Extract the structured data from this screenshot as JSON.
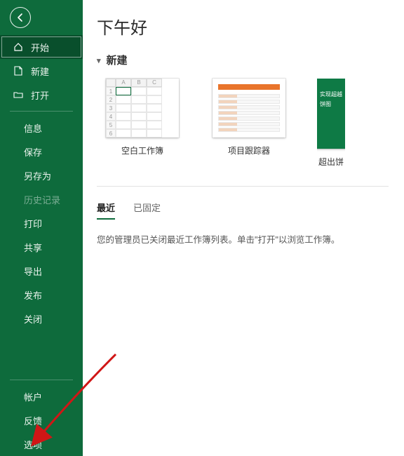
{
  "sidebar": {
    "items": [
      {
        "label": "开始"
      },
      {
        "label": "新建"
      },
      {
        "label": "打开"
      },
      {
        "label": "信息"
      },
      {
        "label": "保存"
      },
      {
        "label": "另存为"
      },
      {
        "label": "历史记录"
      },
      {
        "label": "打印"
      },
      {
        "label": "共享"
      },
      {
        "label": "导出"
      },
      {
        "label": "发布"
      },
      {
        "label": "关闭"
      },
      {
        "label": "帐户"
      },
      {
        "label": "反馈"
      },
      {
        "label": "选项"
      }
    ]
  },
  "main": {
    "greeting": "下午好",
    "new_section": "新建",
    "templates": [
      {
        "label": "空白工作簿"
      },
      {
        "label": "项目跟踪器"
      },
      {
        "label": "超出饼"
      }
    ],
    "pie_lines": [
      "实现超越",
      "饼图"
    ],
    "tabs": {
      "recent": "最近",
      "pinned": "已固定"
    },
    "recent_message": "您的管理员已关闭最近工作簿列表。单击\"打开\"以浏览工作簿。"
  }
}
